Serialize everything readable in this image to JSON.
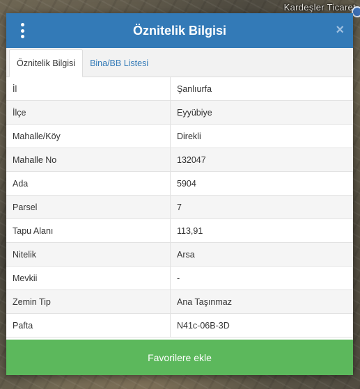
{
  "map": {
    "label": "Kardeşler Ticaret"
  },
  "modal": {
    "title": "Öznitelik Bilgisi",
    "menu_icon": "kebab-menu-icon",
    "close_icon": "close-icon",
    "close_symbol": "×",
    "tabs": [
      {
        "label": "Öznitelik Bilgisi",
        "active": true
      },
      {
        "label": "Bina/BB Listesi",
        "active": false
      }
    ],
    "rows": [
      {
        "key": "İl",
        "value": "Şanlıurfa"
      },
      {
        "key": "İlçe",
        "value": "Eyyübiye"
      },
      {
        "key": "Mahalle/Köy",
        "value": "Direkli"
      },
      {
        "key": "Mahalle No",
        "value": "132047"
      },
      {
        "key": "Ada",
        "value": "5904"
      },
      {
        "key": "Parsel",
        "value": "7"
      },
      {
        "key": "Tapu Alanı",
        "value": "113,91"
      },
      {
        "key": "Nitelik",
        "value": "Arsa"
      },
      {
        "key": "Mevkii",
        "value": "-"
      },
      {
        "key": "Zemin Tip",
        "value": "Ana Taşınmaz"
      },
      {
        "key": "Pafta",
        "value": "N41c-06B-3D"
      }
    ],
    "favorite_button": "Favorilere ekle"
  },
  "colors": {
    "header": "#337ab7",
    "button": "#5cb85c",
    "link": "#337ab7"
  }
}
